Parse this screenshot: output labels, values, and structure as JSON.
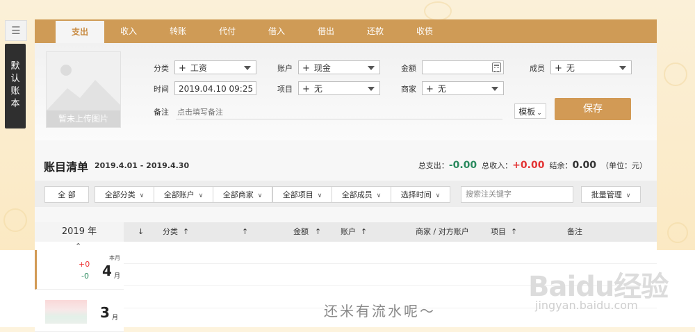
{
  "menu": {
    "icon": "hamburger-icon"
  },
  "side_tab": {
    "label": "默认账本"
  },
  "tabs": [
    {
      "label": "支出",
      "active": true
    },
    {
      "label": "收入"
    },
    {
      "label": "转账"
    },
    {
      "label": "代付"
    },
    {
      "label": "借入"
    },
    {
      "label": "借出"
    },
    {
      "label": "还款"
    },
    {
      "label": "收债"
    }
  ],
  "photo": {
    "label": "暂未上传图片",
    "icon": "image-placeholder-icon"
  },
  "form": {
    "category_label": "分类",
    "category_value": "工资",
    "account_label": "账户",
    "account_value": "现金",
    "amount_label": "金额",
    "amount_value": "",
    "member_label": "成员",
    "member_value": "无",
    "time_label": "时间",
    "time_value": "2019.04.10 09:25",
    "project_label": "项目",
    "project_value": "无",
    "merchant_label": "商家",
    "merchant_value": "无",
    "note_label": "备注",
    "note_placeholder": "点击填写备注",
    "template_label": "模板",
    "save_label": "保存"
  },
  "list": {
    "title": "账目清单",
    "range": "2019.4.01 - 2019.4.30",
    "expense_label": "总支出：",
    "expense_value": "-0.00",
    "income_label": "总收入：",
    "income_value": "+0.00",
    "balance_label": "结余：",
    "balance_value": "0.00",
    "unit": "（单位：元）"
  },
  "filters": [
    {
      "label": "全 部"
    },
    {
      "label": "全部分类"
    },
    {
      "label": "全部账户"
    },
    {
      "label": "全部商家"
    },
    {
      "label": "全部项目"
    },
    {
      "label": "全部成员"
    },
    {
      "label": "选择时间"
    }
  ],
  "search_placeholder": "搜索注关键字",
  "batch_label": "批量管理",
  "table": {
    "year": "2019 年",
    "columns": [
      "分类",
      "金额",
      "账户",
      "商家 / 对方账户",
      "项目",
      "备注"
    ],
    "up_arrow": "↑",
    "down_arrow": "↓"
  },
  "months": [
    {
      "tag": "本月",
      "income": "+0",
      "expense": "-0",
      "month": "4",
      "unit": "月"
    },
    {
      "month": "3",
      "unit": "月"
    }
  ],
  "empty_text": "还米有流水呢～",
  "watermark": {
    "logo": "Baidu经验",
    "url": "jingyan.baidu.com"
  },
  "colors": {
    "accent": "#cf9b56",
    "income": "#e33333",
    "expense": "#2a8a5e"
  }
}
